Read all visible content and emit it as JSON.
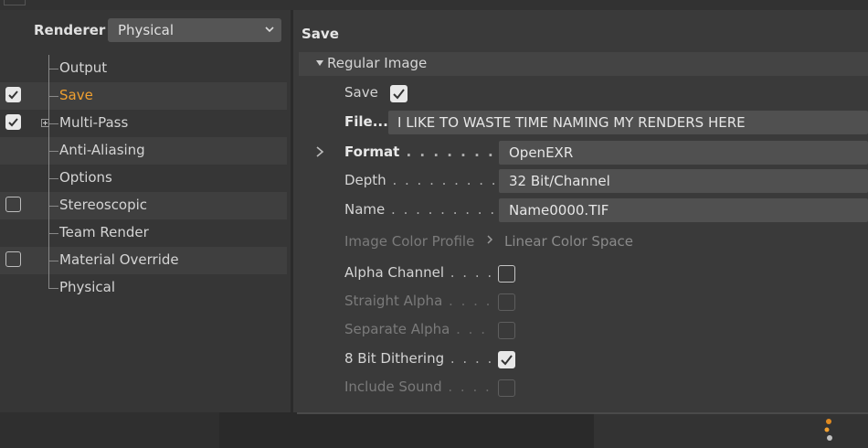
{
  "renderer": {
    "label": "Renderer",
    "value": "Physical"
  },
  "tree": [
    {
      "label": "Output",
      "checkbox": null,
      "active": false,
      "expandable": false
    },
    {
      "label": "Save",
      "checkbox": true,
      "active": true,
      "expandable": false
    },
    {
      "label": "Multi-Pass",
      "checkbox": true,
      "active": false,
      "expandable": true
    },
    {
      "label": "Anti-Aliasing",
      "checkbox": null,
      "active": false,
      "expandable": false
    },
    {
      "label": "Options",
      "checkbox": null,
      "active": false,
      "expandable": false
    },
    {
      "label": "Stereoscopic",
      "checkbox": false,
      "active": false,
      "expandable": false
    },
    {
      "label": "Team Render",
      "checkbox": null,
      "active": false,
      "expandable": false
    },
    {
      "label": "Material Override",
      "checkbox": false,
      "active": false,
      "expandable": false
    },
    {
      "label": "Physical",
      "checkbox": null,
      "active": false,
      "expandable": false
    }
  ],
  "section": {
    "title": "Save",
    "group": "Regular Image",
    "save_label": "Save",
    "save_checked": true,
    "file_label": "File...",
    "file_value": "I LIKE TO WASTE TIME NAMING MY RENDERS HERE",
    "format_label": "Format",
    "format_value": "OpenEXR",
    "depth_label": "Depth",
    "depth_value": "32 Bit/Channel",
    "name_label": "Name",
    "name_value": "Name0000.TIF",
    "profile_label": "Image Color Profile",
    "profile_value": "Linear Color Space",
    "alpha_label": "Alpha Channel",
    "alpha_checked": false,
    "straight_label": "Straight Alpha",
    "straight_checked": false,
    "separate_label": "Separate Alpha",
    "separate_checked": false,
    "dither_label": "8 Bit Dithering",
    "dither_checked": true,
    "sound_label": "Include Sound",
    "sound_checked": false
  },
  "colors": {
    "active": "#f0a030",
    "panel": "#3a3a3a",
    "field": "#505050"
  },
  "icons": [
    "chevron-down-icon",
    "checkmark-icon",
    "expand-plus-icon",
    "triangle-down-icon",
    "chevron-right-icon"
  ]
}
